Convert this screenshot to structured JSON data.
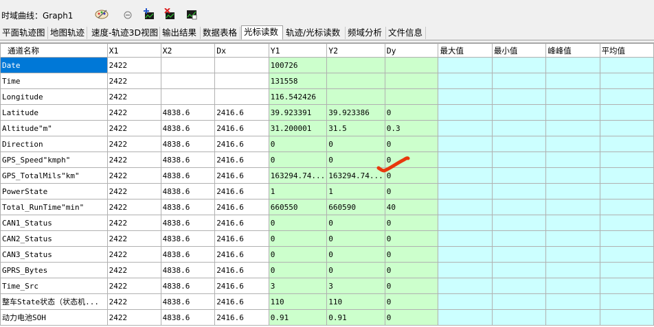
{
  "window": {
    "title": "时域曲线：Graph1"
  },
  "toolbar": {
    "icons": [
      "palette-icon",
      "zoom-reset-icon",
      "add-cursor-icon",
      "delete-cursor-icon",
      "chart-export-icon"
    ]
  },
  "tabs": [
    {
      "label": "平面轨迹图"
    },
    {
      "label": "地图轨迹"
    },
    {
      "label": "速度-轨迹3D视图"
    },
    {
      "label": "输出结果"
    },
    {
      "label": "数据表格"
    },
    {
      "label": "光标读数",
      "active": true
    },
    {
      "label": "轨迹/光标读数"
    },
    {
      "label": "频域分析"
    },
    {
      "label": "文件信息"
    }
  ],
  "table": {
    "headers": [
      "通道名称",
      "X1",
      "X2",
      "Dx",
      "Y1",
      "Y2",
      "Dy",
      "最大值",
      "最小值",
      "峰峰值",
      "平均值"
    ],
    "rows": [
      [
        "Date",
        "2422",
        "",
        "",
        "100726",
        "",
        "",
        "",
        "",
        "",
        ""
      ],
      [
        "Time",
        "2422",
        "",
        "",
        "131558",
        "",
        "",
        "",
        "",
        "",
        ""
      ],
      [
        "Longitude",
        "2422",
        "",
        "",
        "116.542426",
        "",
        "",
        "",
        "",
        "",
        ""
      ],
      [
        "Latitude",
        "2422",
        "4838.6",
        "2416.6",
        "39.923391",
        "39.923386",
        "0",
        "",
        "",
        "",
        ""
      ],
      [
        "Altitude\"m\"",
        "2422",
        "4838.6",
        "2416.6",
        "31.200001",
        "31.5",
        "0.3",
        "",
        "",
        "",
        ""
      ],
      [
        "Direction",
        "2422",
        "4838.6",
        "2416.6",
        "0",
        "0",
        "0",
        "",
        "",
        "",
        ""
      ],
      [
        "GPS_Speed\"kmph\"",
        "2422",
        "4838.6",
        "2416.6",
        "0",
        "0",
        "0",
        "",
        "",
        "",
        ""
      ],
      [
        "GPS_TotalMils\"km\"",
        "2422",
        "4838.6",
        "2416.6",
        "163294.74...",
        "163294.74...",
        "0",
        "",
        "",
        "",
        ""
      ],
      [
        "PowerState",
        "2422",
        "4838.6",
        "2416.6",
        "1",
        "1",
        "0",
        "",
        "",
        "",
        ""
      ],
      [
        "Total_RunTime\"min\"",
        "2422",
        "4838.6",
        "2416.6",
        "660550",
        "660590",
        "40",
        "",
        "",
        "",
        ""
      ],
      [
        "CAN1_Status",
        "2422",
        "4838.6",
        "2416.6",
        "0",
        "0",
        "0",
        "",
        "",
        "",
        ""
      ],
      [
        "CAN2_Status",
        "2422",
        "4838.6",
        "2416.6",
        "0",
        "0",
        "0",
        "",
        "",
        "",
        ""
      ],
      [
        "CAN3_Status",
        "2422",
        "4838.6",
        "2416.6",
        "0",
        "0",
        "0",
        "",
        "",
        "",
        ""
      ],
      [
        "GPRS_Bytes",
        "2422",
        "4838.6",
        "2416.6",
        "0",
        "0",
        "0",
        "",
        "",
        "",
        ""
      ],
      [
        "Time_Src",
        "2422",
        "4838.6",
        "2416.6",
        "3",
        "3",
        "0",
        "",
        "",
        "",
        ""
      ],
      [
        "整车State状态（状态机...",
        "2422",
        "4838.6",
        "2416.6",
        "110",
        "110",
        "0",
        "",
        "",
        "",
        ""
      ],
      [
        "动力电池SOH",
        "2422",
        "4838.6",
        "2416.6",
        "0.91",
        "0.91",
        "0",
        "",
        "",
        "",
        ""
      ]
    ],
    "selected_row": 0
  },
  "colors": {
    "selection": "#0078d7",
    "y_columns_bg": "#ccffcc",
    "stat_columns_bg": "#ccffff",
    "annotation_mark": "#e8380d"
  }
}
